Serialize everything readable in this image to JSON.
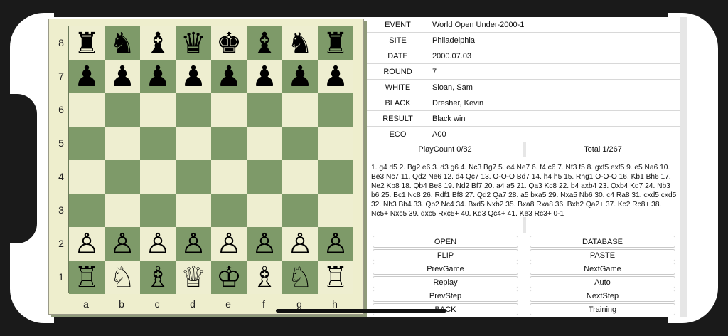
{
  "board": {
    "ranks": [
      "8",
      "7",
      "6",
      "5",
      "4",
      "3",
      "2",
      "1"
    ],
    "files": [
      "a",
      "b",
      "c",
      "d",
      "e",
      "f",
      "g",
      "h"
    ],
    "rows": [
      [
        "♜",
        "♞",
        "♝",
        "♛",
        "♚",
        "♝",
        "♞",
        "♜"
      ],
      [
        "♟",
        "♟",
        "♟",
        "♟",
        "♟",
        "♟",
        "♟",
        "♟"
      ],
      [
        "",
        "",
        "",
        "",
        "",
        "",
        "",
        ""
      ],
      [
        "",
        "",
        "",
        "",
        "",
        "",
        "",
        ""
      ],
      [
        "",
        "",
        "",
        "",
        "",
        "",
        "",
        ""
      ],
      [
        "",
        "",
        "",
        "",
        "",
        "",
        "",
        ""
      ],
      [
        "♙",
        "♙",
        "♙",
        "♙",
        "♙",
        "♙",
        "♙",
        "♙"
      ],
      [
        "♖",
        "♘",
        "♗",
        "♕",
        "♔",
        "♗",
        "♘",
        "♖"
      ]
    ]
  },
  "game_info": [
    {
      "key": "EVENT",
      "value": "World Open Under-2000-1"
    },
    {
      "key": "SITE",
      "value": "Philadelphia"
    },
    {
      "key": "DATE",
      "value": "2000.07.03"
    },
    {
      "key": "ROUND",
      "value": "7"
    },
    {
      "key": "WHITE",
      "value": "Sloan, Sam"
    },
    {
      "key": "BLACK",
      "value": "Dresher, Kevin"
    },
    {
      "key": "RESULT",
      "value": "Black win"
    },
    {
      "key": "ECO",
      "value": "A00"
    }
  ],
  "counts": {
    "play_count": "PlayCount 0/82",
    "total": "Total 1/267"
  },
  "moves_text": "1. g4 d5 2. Bg2 e6 3. d3 g6 4. Nc3 Bg7 5. e4 Ne7 6. f4 c6 7. Nf3 f5 8. gxf5 exf5 9. e5 Na6 10. Be3 Nc7 11. Qd2 Ne6 12. d4 Qc7 13. O-O-O Bd7 14. h4 h5 15. Rhg1 O-O-O 16. Kb1 Bh6 17. Ne2 Kb8 18. Qb4 Be8 19. Nd2 Bf7 20. a4 a5 21. Qa3 Kc8 22. b4 axb4 23. Qxb4 Kd7 24. Nb3 b6 25. Bc1 Nc8 26. Rdf1 Bf8 27. Qd2 Qa7 28. a5 bxa5 29. Nxa5 Nb6 30. c4 Ra8 31. cxd5 cxd5 32. Nb3 Bb4 33. Qb2 Nc4 34. Bxd5 Nxb2 35. Bxa8 Rxa8 36. Bxb2 Qa2+ 37. Kc2 Rc8+ 38. Nc5+ Nxc5 39. dxc5 Rxc5+ 40. Kd3 Qc4+ 41. Ke3 Rc3+ 0-1",
  "buttons": {
    "open": "OPEN",
    "database": "DATABASE",
    "flip": "FLIP",
    "paste": "PASTE",
    "prev_game": "PrevGame",
    "next_game": "NextGame",
    "replay": "Replay",
    "auto": "Auto",
    "prev_step": "PrevStep",
    "next_step": "NextStep",
    "back": "BACK",
    "training": "Training"
  }
}
